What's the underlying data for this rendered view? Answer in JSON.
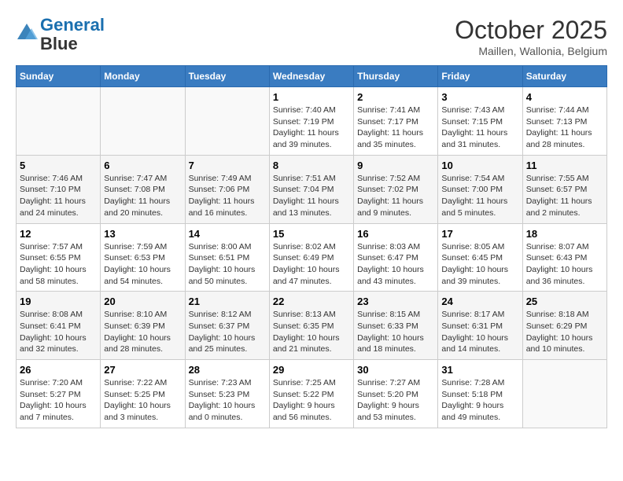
{
  "header": {
    "logo_line1": "General",
    "logo_line2": "Blue",
    "month": "October 2025",
    "location": "Maillen, Wallonia, Belgium"
  },
  "days_of_week": [
    "Sunday",
    "Monday",
    "Tuesday",
    "Wednesday",
    "Thursday",
    "Friday",
    "Saturday"
  ],
  "weeks": [
    [
      {
        "day": "",
        "info": ""
      },
      {
        "day": "",
        "info": ""
      },
      {
        "day": "",
        "info": ""
      },
      {
        "day": "1",
        "info": "Sunrise: 7:40 AM\nSunset: 7:19 PM\nDaylight: 11 hours\nand 39 minutes."
      },
      {
        "day": "2",
        "info": "Sunrise: 7:41 AM\nSunset: 7:17 PM\nDaylight: 11 hours\nand 35 minutes."
      },
      {
        "day": "3",
        "info": "Sunrise: 7:43 AM\nSunset: 7:15 PM\nDaylight: 11 hours\nand 31 minutes."
      },
      {
        "day": "4",
        "info": "Sunrise: 7:44 AM\nSunset: 7:13 PM\nDaylight: 11 hours\nand 28 minutes."
      }
    ],
    [
      {
        "day": "5",
        "info": "Sunrise: 7:46 AM\nSunset: 7:10 PM\nDaylight: 11 hours\nand 24 minutes."
      },
      {
        "day": "6",
        "info": "Sunrise: 7:47 AM\nSunset: 7:08 PM\nDaylight: 11 hours\nand 20 minutes."
      },
      {
        "day": "7",
        "info": "Sunrise: 7:49 AM\nSunset: 7:06 PM\nDaylight: 11 hours\nand 16 minutes."
      },
      {
        "day": "8",
        "info": "Sunrise: 7:51 AM\nSunset: 7:04 PM\nDaylight: 11 hours\nand 13 minutes."
      },
      {
        "day": "9",
        "info": "Sunrise: 7:52 AM\nSunset: 7:02 PM\nDaylight: 11 hours\nand 9 minutes."
      },
      {
        "day": "10",
        "info": "Sunrise: 7:54 AM\nSunset: 7:00 PM\nDaylight: 11 hours\nand 5 minutes."
      },
      {
        "day": "11",
        "info": "Sunrise: 7:55 AM\nSunset: 6:57 PM\nDaylight: 11 hours\nand 2 minutes."
      }
    ],
    [
      {
        "day": "12",
        "info": "Sunrise: 7:57 AM\nSunset: 6:55 PM\nDaylight: 10 hours\nand 58 minutes."
      },
      {
        "day": "13",
        "info": "Sunrise: 7:59 AM\nSunset: 6:53 PM\nDaylight: 10 hours\nand 54 minutes."
      },
      {
        "day": "14",
        "info": "Sunrise: 8:00 AM\nSunset: 6:51 PM\nDaylight: 10 hours\nand 50 minutes."
      },
      {
        "day": "15",
        "info": "Sunrise: 8:02 AM\nSunset: 6:49 PM\nDaylight: 10 hours\nand 47 minutes."
      },
      {
        "day": "16",
        "info": "Sunrise: 8:03 AM\nSunset: 6:47 PM\nDaylight: 10 hours\nand 43 minutes."
      },
      {
        "day": "17",
        "info": "Sunrise: 8:05 AM\nSunset: 6:45 PM\nDaylight: 10 hours\nand 39 minutes."
      },
      {
        "day": "18",
        "info": "Sunrise: 8:07 AM\nSunset: 6:43 PM\nDaylight: 10 hours\nand 36 minutes."
      }
    ],
    [
      {
        "day": "19",
        "info": "Sunrise: 8:08 AM\nSunset: 6:41 PM\nDaylight: 10 hours\nand 32 minutes."
      },
      {
        "day": "20",
        "info": "Sunrise: 8:10 AM\nSunset: 6:39 PM\nDaylight: 10 hours\nand 28 minutes."
      },
      {
        "day": "21",
        "info": "Sunrise: 8:12 AM\nSunset: 6:37 PM\nDaylight: 10 hours\nand 25 minutes."
      },
      {
        "day": "22",
        "info": "Sunrise: 8:13 AM\nSunset: 6:35 PM\nDaylight: 10 hours\nand 21 minutes."
      },
      {
        "day": "23",
        "info": "Sunrise: 8:15 AM\nSunset: 6:33 PM\nDaylight: 10 hours\nand 18 minutes."
      },
      {
        "day": "24",
        "info": "Sunrise: 8:17 AM\nSunset: 6:31 PM\nDaylight: 10 hours\nand 14 minutes."
      },
      {
        "day": "25",
        "info": "Sunrise: 8:18 AM\nSunset: 6:29 PM\nDaylight: 10 hours\nand 10 minutes."
      }
    ],
    [
      {
        "day": "26",
        "info": "Sunrise: 7:20 AM\nSunset: 5:27 PM\nDaylight: 10 hours\nand 7 minutes."
      },
      {
        "day": "27",
        "info": "Sunrise: 7:22 AM\nSunset: 5:25 PM\nDaylight: 10 hours\nand 3 minutes."
      },
      {
        "day": "28",
        "info": "Sunrise: 7:23 AM\nSunset: 5:23 PM\nDaylight: 10 hours\nand 0 minutes."
      },
      {
        "day": "29",
        "info": "Sunrise: 7:25 AM\nSunset: 5:22 PM\nDaylight: 9 hours\nand 56 minutes."
      },
      {
        "day": "30",
        "info": "Sunrise: 7:27 AM\nSunset: 5:20 PM\nDaylight: 9 hours\nand 53 minutes."
      },
      {
        "day": "31",
        "info": "Sunrise: 7:28 AM\nSunset: 5:18 PM\nDaylight: 9 hours\nand 49 minutes."
      },
      {
        "day": "",
        "info": ""
      }
    ]
  ]
}
